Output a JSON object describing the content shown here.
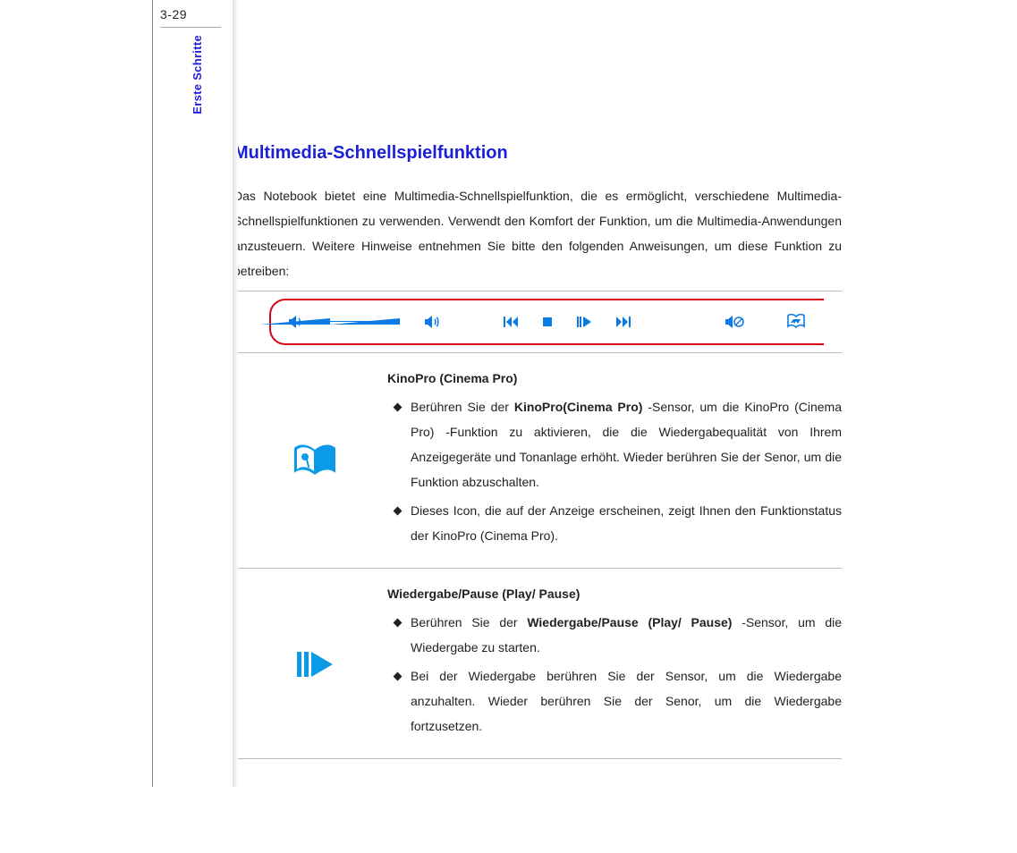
{
  "page_number": "3-29",
  "side_label": "Erste Schritte",
  "title": "Multimedia-Schnellspielfunktion",
  "intro": "Das Notebook bietet eine Multimedia-Schnellspielfunktion, die es ermöglicht, verschiedene Multimedia-Schnellspielfunktionen zu verwenden. Verwendt den Komfort der Funktion, um die Multimedia-Anwendungen anzusteuern.   Weitere  Hinweise  entnehmen  Sie  bitte  den folgenden Anweisungen, um diese Funktion zu betreiben:",
  "panel_icons": [
    "volume-down-icon",
    "volume-slider",
    "volume-up-icon",
    "previous-icon",
    "stop-icon",
    "play-pause-icon",
    "next-icon",
    "mute-icon",
    "cinema-pro-icon"
  ],
  "features": [
    {
      "icon": "cinema-pro",
      "title": "KinoPro (Cinema Pro)",
      "items": [
        {
          "pre": "Berühren Sie der ",
          "bold": "KinoPro(Cinema Pro)",
          "post": " -Sensor, um die KinoPro (Cinema Pro) -Funktion zu aktivieren, die die Wiedergabequalität von Ihrem Anzeigegeräte und Tonanlage erhöht. Wieder berühren Sie der Senor, um die Funktion abzuschalten."
        },
        {
          "pre": "Dieses Icon, die auf der Anzeige erscheinen, zeigt Ihnen den Funktionstatus der KinoPro (Cinema Pro).",
          "bold": "",
          "post": ""
        }
      ]
    },
    {
      "icon": "play-pause",
      "title": "Wiedergabe/Pause (Play/ Pause)",
      "items": [
        {
          "pre": "Berühren Sie der ",
          "bold": "Wiedergabe/Pause (Play/ Pause)",
          "post": " -Sensor, um die Wiedergabe zu starten."
        },
        {
          "pre": "Bei der Wiedergabe berühren Sie der Sensor, um die Wiedergabe anzuhalten.  Wieder berühren Sie der Senor, um die Wiedergabe fortzusetzen.",
          "bold": "",
          "post": ""
        }
      ]
    }
  ]
}
